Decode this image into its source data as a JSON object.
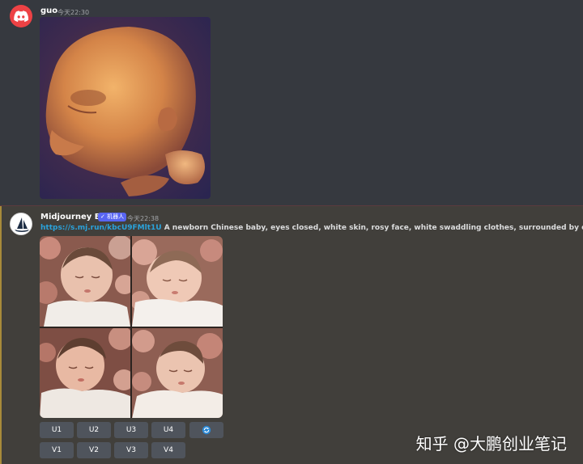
{
  "messages": [
    {
      "author": "guo",
      "time": "今天22:30",
      "avatar_icon": "discord-logo-icon",
      "attachment": "ultrasound-image"
    },
    {
      "author": "Midjourney Bot",
      "badge": "✓ 机器人",
      "time": "今天22:38",
      "avatar_icon": "midjourney-boat-icon",
      "prompt_link": "https://s.mj.run/kbcU9FMlt1U",
      "prompt_text": " A newborn Chinese baby, eyes closed, white skin, rosy face, white swaddling clothes, surrounded by dreamy rose flo",
      "attachment": "four-image-grid"
    }
  ],
  "buttons": {
    "upscale": [
      "U1",
      "U2",
      "U3",
      "U4"
    ],
    "variation": [
      "V1",
      "V2",
      "V3",
      "V4"
    ],
    "reroll_icon": "refresh-icon"
  },
  "watermark": "知乎 @大鹏创业笔记",
  "colors": {
    "background": "#36393f",
    "bot_message_highlight": "#413f3b",
    "link": "#2aa3dc",
    "button": "#4f545c",
    "badge": "#5865f2",
    "discord_red": "#ed4245"
  }
}
